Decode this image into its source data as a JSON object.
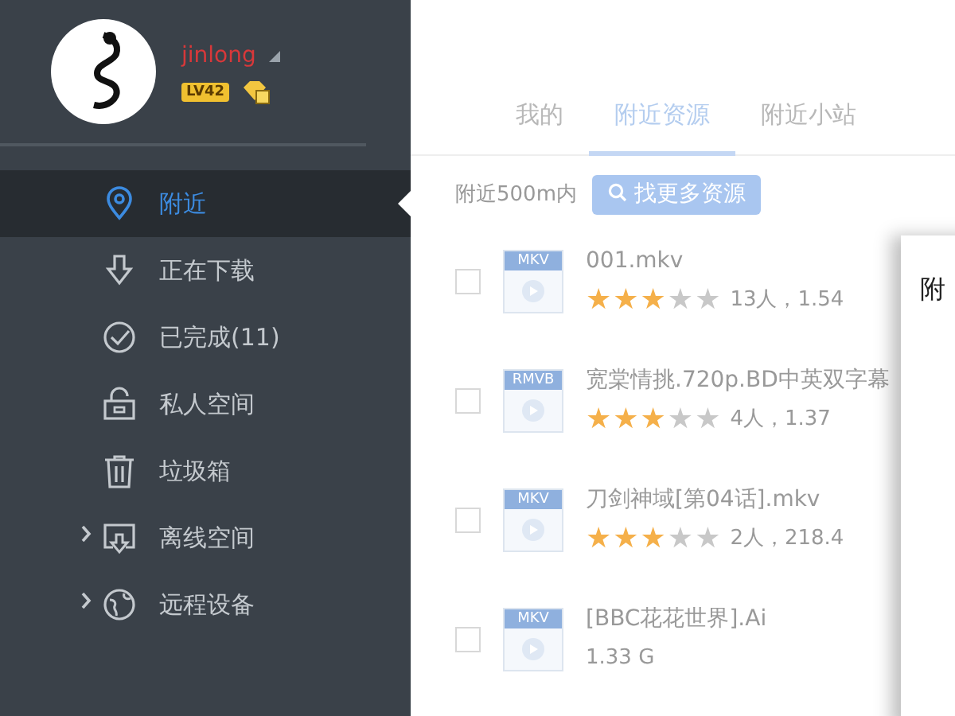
{
  "user": {
    "name": "jinlong",
    "level_badge": "LV42"
  },
  "sidebar": {
    "items": [
      {
        "label": "附近",
        "selected": true,
        "expandable": false
      },
      {
        "label": "正在下载",
        "selected": false,
        "expandable": false
      },
      {
        "label": "已完成(11)",
        "selected": false,
        "expandable": false
      },
      {
        "label": "私人空间",
        "selected": false,
        "expandable": false
      },
      {
        "label": "垃圾箱",
        "selected": false,
        "expandable": false
      },
      {
        "label": "离线空间",
        "selected": false,
        "expandable": true
      },
      {
        "label": "远程设备",
        "selected": false,
        "expandable": true
      }
    ]
  },
  "tabs": [
    {
      "label": "我的",
      "selected": false
    },
    {
      "label": "附近资源",
      "selected": true
    },
    {
      "label": "附近小站",
      "selected": false
    }
  ],
  "filter": {
    "range": "附近500m内",
    "button": "找更多资源"
  },
  "files": [
    {
      "type": "MKV",
      "name": "001.mkv",
      "stars": 3,
      "meta": "13人，1.54",
      "checked": false
    },
    {
      "type": "RMVB",
      "name": "宽棠情挑.720p.BD中英双字幕",
      "stars": 3,
      "meta": "4人，1.37",
      "checked": false
    },
    {
      "type": "MKV",
      "name": "刀剑神域[第04话].mkv",
      "stars": 3,
      "meta": "2人，218.4",
      "checked": false
    },
    {
      "type": "MKV",
      "name": "[BBC花花世界].Ai",
      "meta": "1.33 G",
      "checked": false
    }
  ],
  "side_panel": {
    "title": "附"
  }
}
